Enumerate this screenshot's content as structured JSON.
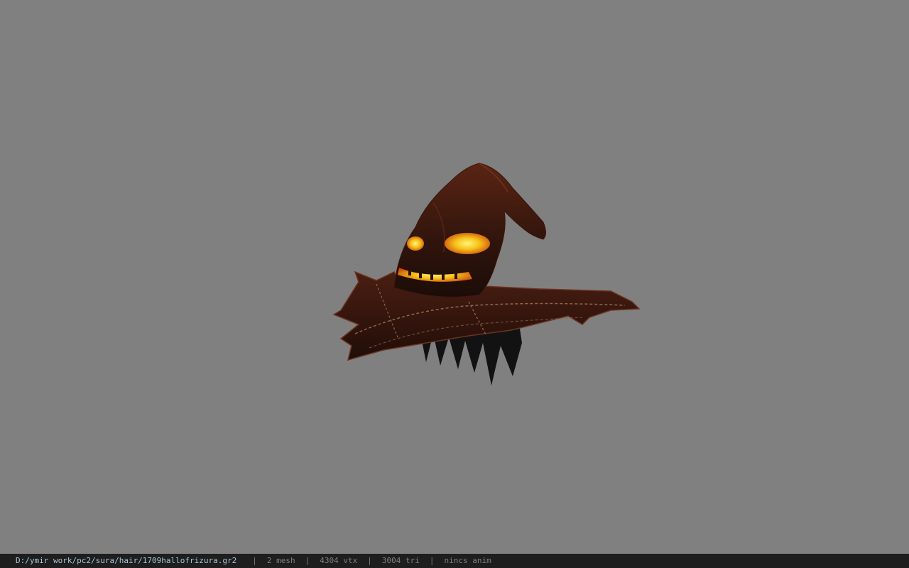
{
  "viewer": {
    "background_color": "#808080",
    "model_name": "halloween-witch-hat-hair-model"
  },
  "statusbar": {
    "file_path": "D:/ymir work/pc2/sura/hair/1709hallofrizura.gr2",
    "separator": "|",
    "mesh": "2 mesh",
    "vtx": "4304 vtx",
    "tri": "3004 tri",
    "anim": "nincs anim",
    "path_color": "#a9c4d8",
    "text_color": "#7f7f7f"
  }
}
